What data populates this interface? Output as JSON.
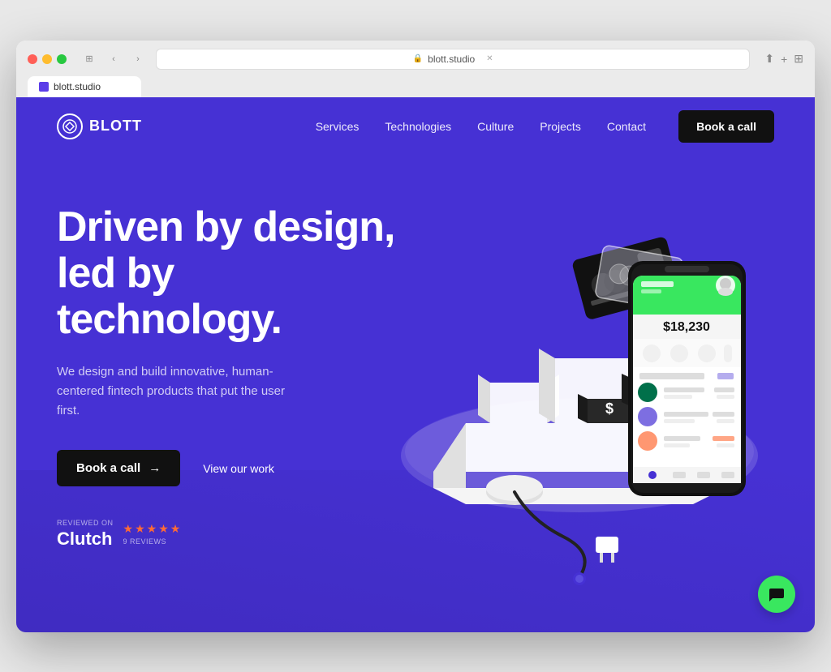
{
  "browser": {
    "url": "blott.studio",
    "tab_label": "blott.studio",
    "favicon_color": "#4631d4"
  },
  "nav": {
    "logo_text": "BLOTT",
    "links": [
      "Services",
      "Technologies",
      "Culture",
      "Projects"
    ],
    "contact_label": "Contact",
    "book_call_label": "Book a call"
  },
  "hero": {
    "headline_line1": "Driven by design,",
    "headline_line2": "led by technology.",
    "subtext": "We design and build innovative, human-centered fintech products that put the user first.",
    "book_call_label": "Book a call",
    "arrow": "→",
    "view_work_label": "View our work"
  },
  "clutch": {
    "reviewed_on": "REVIEWED ON",
    "name": "Clutch",
    "reviews_label": "9 REVIEWS",
    "star_count": 5
  },
  "chat": {
    "icon": "💬"
  }
}
